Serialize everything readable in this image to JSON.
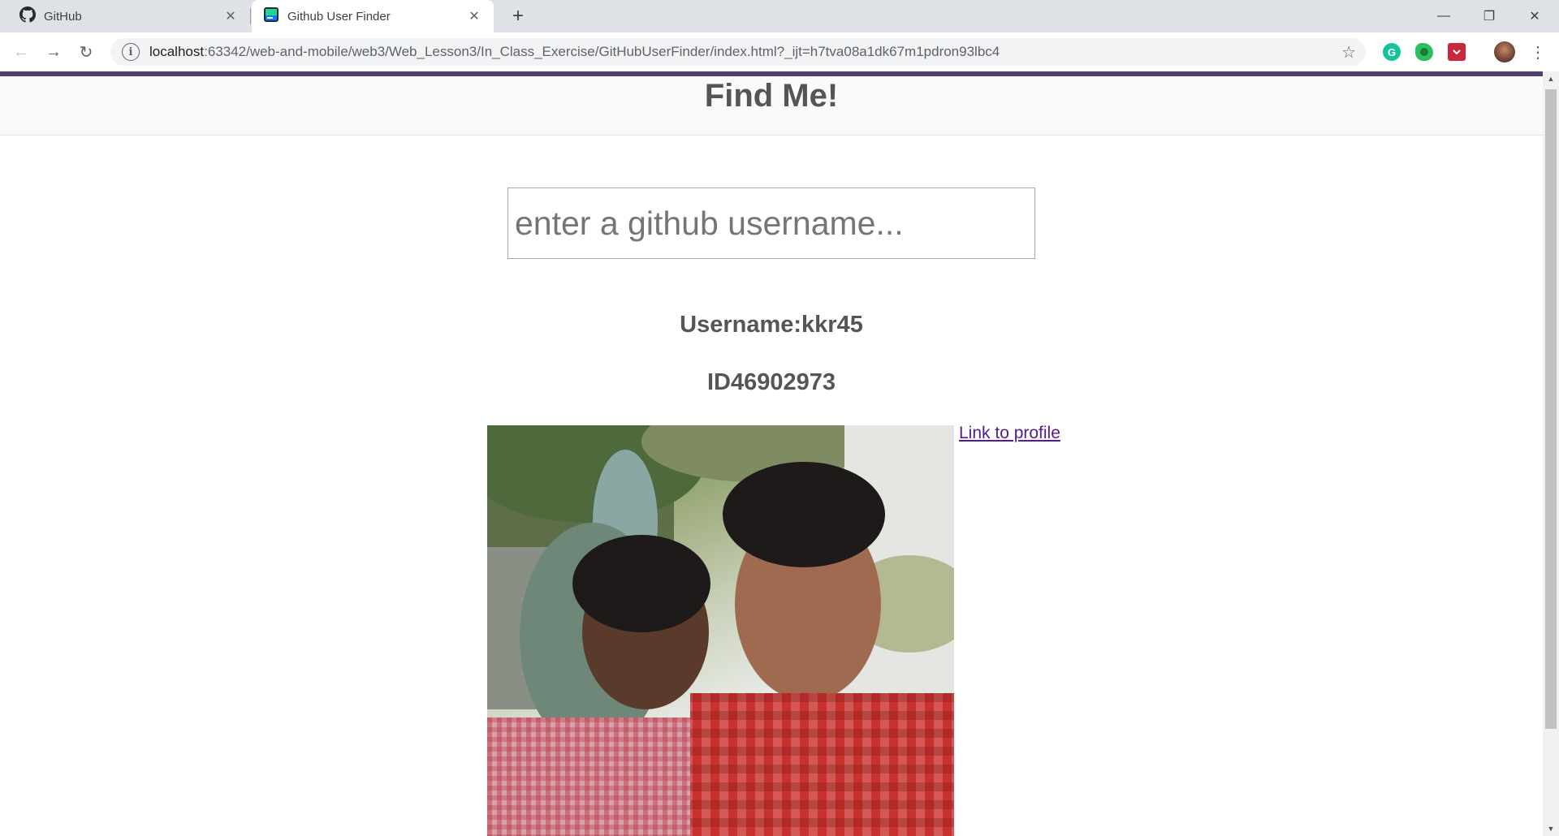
{
  "browser": {
    "tabs": [
      {
        "title": "GitHub",
        "icon": "github-icon"
      },
      {
        "title": "Github User Finder",
        "icon": "app-favicon"
      }
    ],
    "new_tab_label": "+",
    "url_host": "localhost",
    "url_path": ":63342/web-and-mobile/web3/Web_Lesson3/In_Class_Exercise/GitHubUserFinder/index.html?_ijt=h7tva08a1dk67m1pdron93lbc4",
    "extensions": [
      {
        "name": "grammarly-icon",
        "letter": "G",
        "color": "#15c39a"
      },
      {
        "name": "evernote-icon",
        "letter": "E",
        "color": "#2dbe60"
      },
      {
        "name": "pocket-icon",
        "letter": "P",
        "color": "#c9273d"
      }
    ]
  },
  "page": {
    "title": "Find Me!",
    "search_placeholder": "enter a github username...",
    "username_line": "Username:kkr45",
    "id_line": "ID46902973",
    "profile_link_label": "Link to profile"
  },
  "colors": {
    "accent_bar": "#4f3f6a",
    "link": "#551a8b",
    "heading": "#555555"
  }
}
